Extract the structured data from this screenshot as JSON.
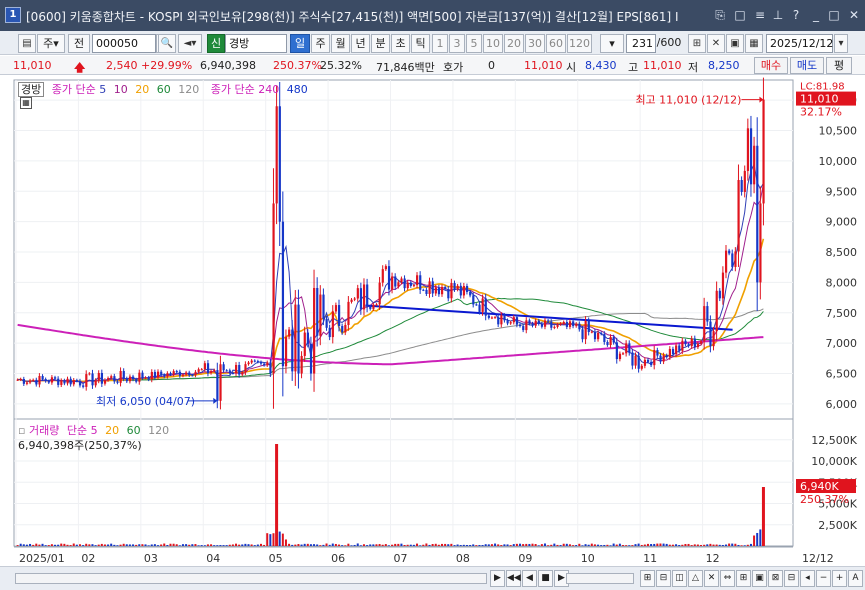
{
  "window": {
    "title": "[0600] 키움종합차트 - KOSPI 외국인보유[298(천)] 주식수[27,415(천)] 액면[500] 자본금[137(억)] 결산[12월] EPS[861] I",
    "app_icon_label": "1"
  },
  "toolbar": {
    "period_label": "주",
    "market_label": "전",
    "code_value": "000050",
    "name_badge": "신",
    "stock_name": "경방",
    "periods": [
      "일",
      "주",
      "월",
      "년",
      "분",
      "초",
      "틱"
    ],
    "active_period": "일",
    "intervals": [
      "1",
      "3",
      "5",
      "10",
      "20",
      "30",
      "60",
      "120"
    ],
    "count_value": "231",
    "count_total": "/600",
    "date_value": "2025/12/12"
  },
  "quote": {
    "price": "11,010",
    "change": "2,540",
    "change_rate": "+29.99%",
    "volume": "6,940,398",
    "volume_ratio": "250.37%",
    "turnover": "25.32%",
    "amount": "71,846백만",
    "hoga_label": "호가",
    "hoga_value": "0",
    "ask": "11,010",
    "open_label": "시",
    "open": "8,430",
    "high_label": "고",
    "high": "11,010",
    "low_label": "저",
    "low": "8,250",
    "buy_label": "매수",
    "sell_label": "매도",
    "eval_label": "평"
  },
  "legend": {
    "price_title": "경방",
    "ma_label": "종가 단순",
    "ma_short": [
      "5",
      "10",
      "20",
      "60",
      "120"
    ],
    "ma_long": [
      "240",
      "480"
    ],
    "vol_title": "거래량",
    "vol_ma_label": "단순",
    "vol_ma": [
      "5",
      "20",
      "60",
      "120"
    ],
    "vol_value": "6,940,398주(250,37%)"
  },
  "annotations": {
    "high": "최고 11,010 (12/12)",
    "low": "최저 6,050 (04/07)",
    "price_tag": "11,010",
    "price_tag_pct": "32.17%",
    "lc_tag": "LC:81.98",
    "vol_tag": "6,940K",
    "vol_tag_pct": "250.37%"
  },
  "colors": {
    "up": "#e0141e",
    "down": "#1537c8",
    "ma5": "#2f3fb6",
    "ma10": "#a01f8c",
    "ma20": "#f0a000",
    "ma60": "#1f8a3a",
    "ma120": "#8c8c8c",
    "ma240": "#cc20b8",
    "trendline": "#0a18d0"
  },
  "chart_data": {
    "type": "candlestick",
    "title": "경방",
    "price_axis": {
      "ticks": [
        6000,
        6500,
        7000,
        7500,
        8000,
        8500,
        9000,
        9500,
        10000,
        10500,
        11000
      ],
      "range": [
        5850,
        11250
      ]
    },
    "volume_axis": {
      "ticks": [
        2500,
        5000,
        7500,
        10000,
        12500
      ],
      "unit": "K",
      "range": [
        0,
        14000
      ]
    },
    "x_axis": {
      "ticks": [
        "2025/01",
        "02",
        "03",
        "04",
        "05",
        "06",
        "07",
        "08",
        "09",
        "10",
        "11",
        "12"
      ],
      "right_label": "12/12"
    },
    "months": [
      {
        "label": "2025/01",
        "open": 6400,
        "high": 6750,
        "low": 6250,
        "close": 6380
      },
      {
        "label": "02",
        "open": 6380,
        "high": 6950,
        "low": 6280,
        "close": 6450
      },
      {
        "label": "03",
        "open": 6450,
        "high": 6700,
        "low": 6300,
        "close": 6550
      },
      {
        "label": "04",
        "open": 6550,
        "high": 6800,
        "low": 6050,
        "close": 6600
      },
      {
        "label": "05",
        "open": 6600,
        "high": 10900,
        "low": 6500,
        "close": 7300
      },
      {
        "label": "06",
        "open": 7300,
        "high": 8850,
        "low": 7100,
        "close": 8100
      },
      {
        "label": "07",
        "open": 8100,
        "high": 8500,
        "low": 7500,
        "close": 7900
      },
      {
        "label": "08",
        "open": 7900,
        "high": 8100,
        "low": 7200,
        "close": 7300
      },
      {
        "label": "09",
        "open": 7300,
        "high": 7600,
        "low": 7000,
        "close": 7250
      },
      {
        "label": "10",
        "open": 7250,
        "high": 7400,
        "low": 6350,
        "close": 6700
      },
      {
        "label": "11",
        "open": 6700,
        "high": 7200,
        "low": 6500,
        "close": 7050
      },
      {
        "label": "12",
        "open": 7050,
        "high": 11010,
        "low": 6950,
        "close": 11010
      }
    ],
    "volume_spikes": [
      {
        "label": "05",
        "value": 12000
      },
      {
        "label": "12",
        "value": 6940
      }
    ],
    "extremes": {
      "high": 11010,
      "high_date": "12/12",
      "low": 6050,
      "low_date": "04/07"
    }
  },
  "bottom": {
    "buttons": [
      "▶",
      "◀◀",
      "◀",
      "■",
      "▶"
    ]
  }
}
